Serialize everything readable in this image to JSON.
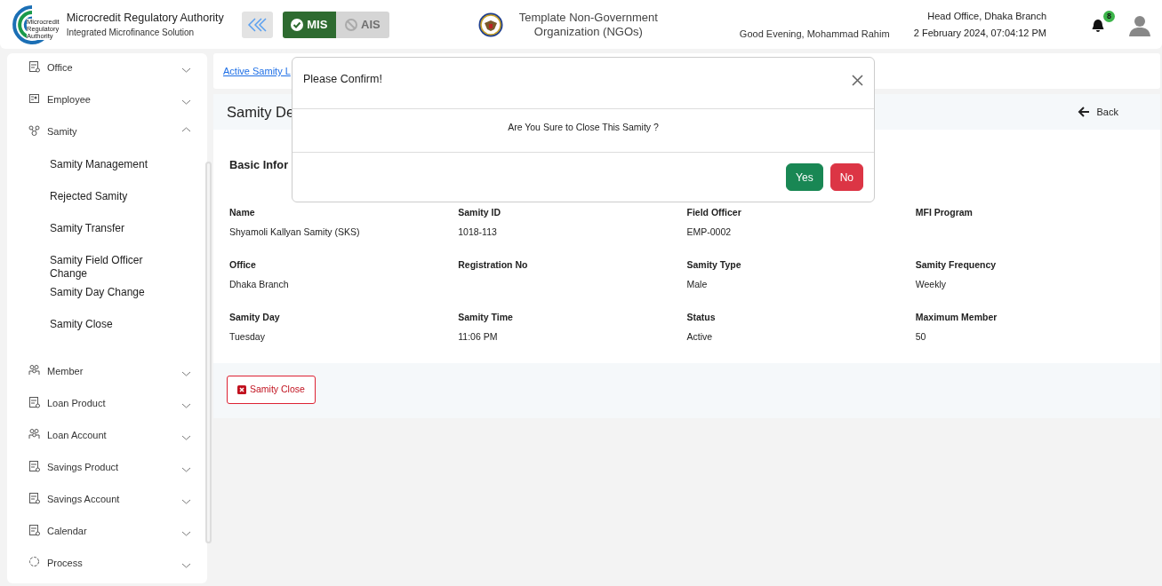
{
  "header": {
    "logo_lines": [
      "Microcredit",
      "Regulatory",
      "Authority"
    ],
    "title": "Microcredit Regulatory Authority",
    "subtitle": "Integrated Microfinance Solution",
    "modules": [
      {
        "label": "MIS",
        "selected": true
      },
      {
        "label": "AIS",
        "selected": false
      }
    ],
    "organization": "Template Non-Government Organization (NGOs)",
    "greeting": "Good Evening, Mohammad Rahim",
    "branch": "Head Office, Dhaka Branch",
    "datetime": "2 February 2024, 07:04:12 PM",
    "notification_count": "8"
  },
  "sidebar": {
    "items": [
      {
        "label": "Office",
        "kind": "document",
        "expanded": false
      },
      {
        "label": "Employee",
        "kind": "badge",
        "expanded": false
      },
      {
        "label": "Samity",
        "kind": "network",
        "expanded": true,
        "children": [
          {
            "label": "Samity Management"
          },
          {
            "label": "Rejected Samity"
          },
          {
            "label": "Samity Transfer"
          },
          {
            "label": "Samity Field Officer Change"
          },
          {
            "label": "Samity Day Change"
          },
          {
            "label": "Samity Close"
          }
        ]
      },
      {
        "label": "Member",
        "kind": "group",
        "expanded": false
      },
      {
        "label": "Loan Product",
        "kind": "document",
        "expanded": false
      },
      {
        "label": "Loan Account",
        "kind": "group",
        "expanded": false
      },
      {
        "label": "Savings Product",
        "kind": "document",
        "expanded": false
      },
      {
        "label": "Savings Account",
        "kind": "document",
        "expanded": false
      },
      {
        "label": "Calendar",
        "kind": "document",
        "expanded": false
      },
      {
        "label": "Process",
        "kind": "process",
        "expanded": false
      }
    ]
  },
  "breadcrumb": {
    "link": "Active Samity L"
  },
  "details": {
    "title": "Samity De",
    "back": "Back",
    "section": "Basic Infor",
    "fields": [
      {
        "label": "Name",
        "value": "Shyamoli Kallyan Samity (SKS)"
      },
      {
        "label": "Samity ID",
        "value": "1018-113"
      },
      {
        "label": "Field Officer",
        "value": "EMP-0002"
      },
      {
        "label": "MFI Program"
      },
      {
        "label": "Office",
        "value": "Dhaka Branch"
      },
      {
        "label": "Registration No"
      },
      {
        "label": "Samity Type",
        "value": "Male"
      },
      {
        "label": "Samity Frequency",
        "value": "Weekly"
      },
      {
        "label": "Samity Day",
        "value": "Tuesday"
      },
      {
        "label": "Samity Time",
        "value": "11:06 PM"
      },
      {
        "label": "Status",
        "value": "Active"
      },
      {
        "label": "Maximum Member",
        "value": "50"
      }
    ],
    "close_button": "Samity Close"
  },
  "modal": {
    "title": "Please Confirm!",
    "message": "Are You Sure to Close This Samity ?",
    "buttons": [
      {
        "label": "Yes",
        "kind": "confirm"
      },
      {
        "label": "No",
        "kind": "cancel"
      }
    ]
  }
}
